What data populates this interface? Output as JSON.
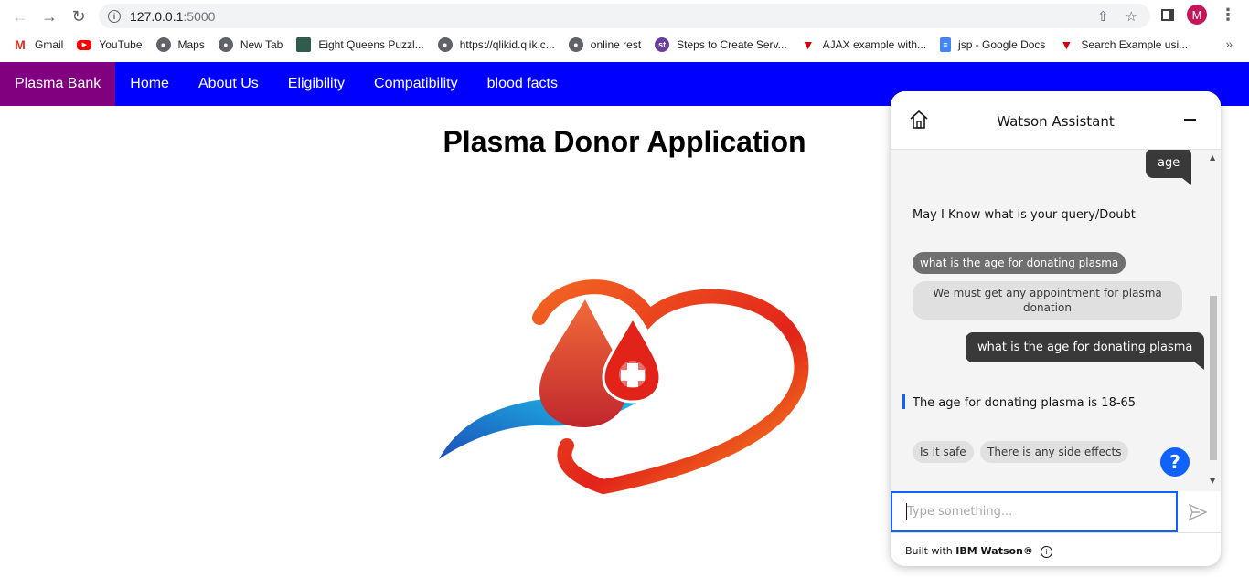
{
  "browser": {
    "url_host": "127.0.0.1",
    "url_port": ":5000",
    "avatar_letter": "M",
    "bookmarks": [
      {
        "label": "Gmail",
        "icon": "gmail-icon"
      },
      {
        "label": "YouTube",
        "icon": "youtube-icon"
      },
      {
        "label": "Maps",
        "icon": "globe-icon"
      },
      {
        "label": "New Tab",
        "icon": "globe-icon"
      },
      {
        "label": "Eight Queens Puzzl...",
        "icon": "image-icon"
      },
      {
        "label": "https://qlikid.qlik.c...",
        "icon": "globe-icon"
      },
      {
        "label": "online rest",
        "icon": "globe-icon"
      },
      {
        "label": "Steps to Create Serv...",
        "icon": "st-icon"
      },
      {
        "label": "AJAX example with...",
        "icon": "triangle-icon"
      },
      {
        "label": "jsp - Google Docs",
        "icon": "docs-icon"
      },
      {
        "label": "Search Example usi...",
        "icon": "triangle-icon"
      }
    ],
    "more_bookmarks": "»"
  },
  "site": {
    "brand": "Plasma Bank",
    "nav": [
      "Home",
      "About Us",
      "Eligibility",
      "Compatibility",
      "blood facts"
    ],
    "title": "Plasma Donor Application"
  },
  "assistant": {
    "title": "Watson Assistant",
    "messages": {
      "user_age": "age",
      "bot_query": "May I Know what is your query/Doubt",
      "option_selected": "what is the age for donating plasma",
      "option_other": "We must get any appointment for plasma donation",
      "user_question": "what is the age for donating plasma",
      "bot_answer": "The age for donating plasma is 18-65",
      "chip_safe": "Is it safe",
      "chip_side": "There is any side effects"
    },
    "help_label": "?",
    "input_placeholder": "Type something...",
    "footer_prefix": "Built with ",
    "footer_brand": "IBM Watson®",
    "colors": {
      "accent": "#0f62fe",
      "user_bubble": "#393939",
      "nav": "#0000ff",
      "brand": "#800080"
    }
  }
}
